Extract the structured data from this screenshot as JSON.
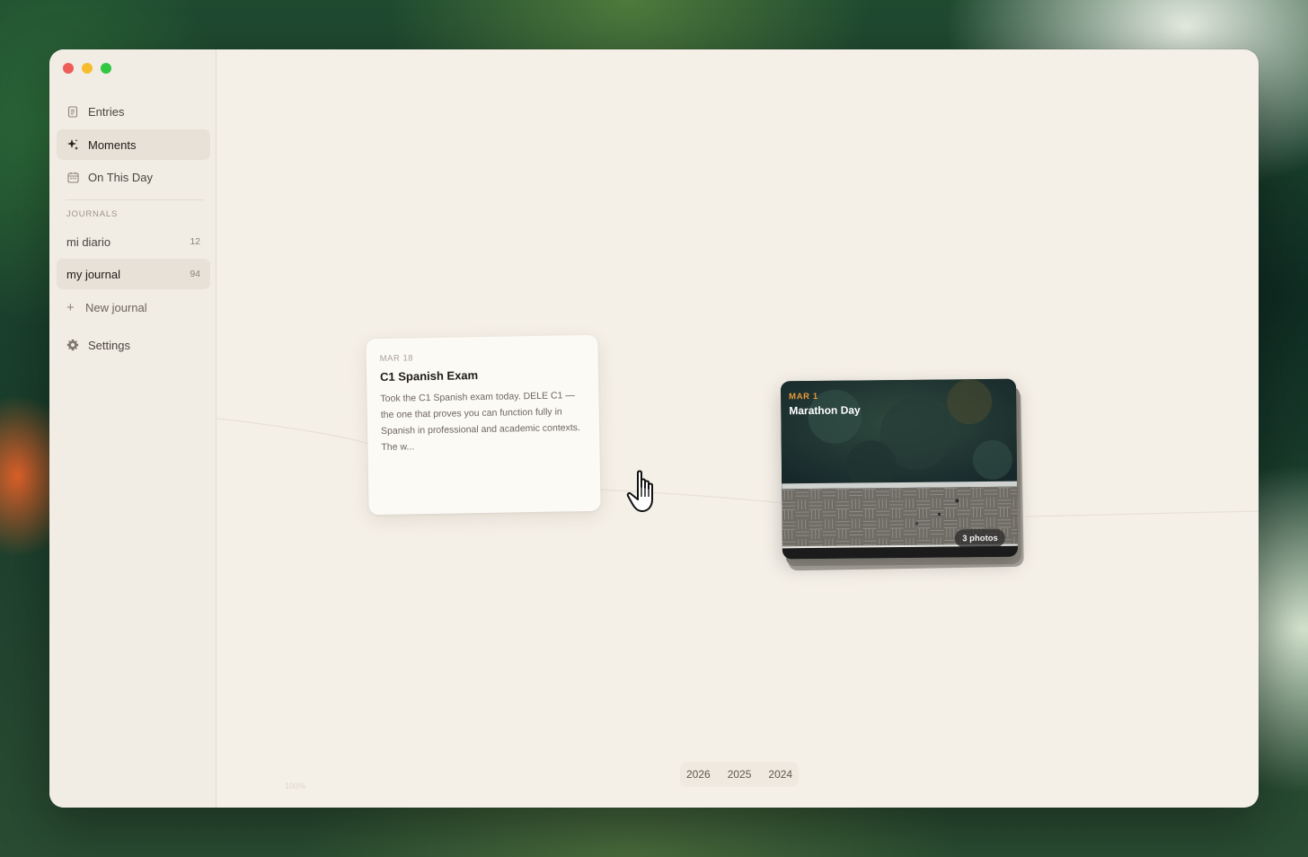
{
  "window": {
    "traffic_lights": [
      "close",
      "minimize",
      "zoom"
    ]
  },
  "sidebar": {
    "nav": [
      {
        "label": "Entries",
        "icon": "document-icon",
        "active": false
      },
      {
        "label": "Moments",
        "icon": "sparkle-icon",
        "active": true
      },
      {
        "label": "On This Day",
        "icon": "calendar-icon",
        "active": false
      }
    ],
    "journals_heading": "JOURNALS",
    "journals": [
      {
        "name": "mi diario",
        "count": "12",
        "active": false
      },
      {
        "name": "my journal",
        "count": "94",
        "active": true
      }
    ],
    "new_journal_label": "New journal",
    "settings_label": "Settings"
  },
  "moments": [
    {
      "kind": "text",
      "date": "MAR 18",
      "title": "C1 Spanish Exam",
      "excerpt": "Took the C1 Spanish exam today. DELE C1 — the one that proves you can function fully in Spanish in professional and academic contexts. The w..."
    },
    {
      "kind": "photo",
      "date": "MAR 1",
      "title": "Marathon Day",
      "photo_count": "3 photos"
    }
  ],
  "year_nav": [
    "2026",
    "2025",
    "2024"
  ],
  "zoom_label": "100%",
  "colors": {
    "window_bg": "#f4efe7",
    "sidebar_active": "#e7e1d7",
    "accent_date": "#e79a3b"
  }
}
